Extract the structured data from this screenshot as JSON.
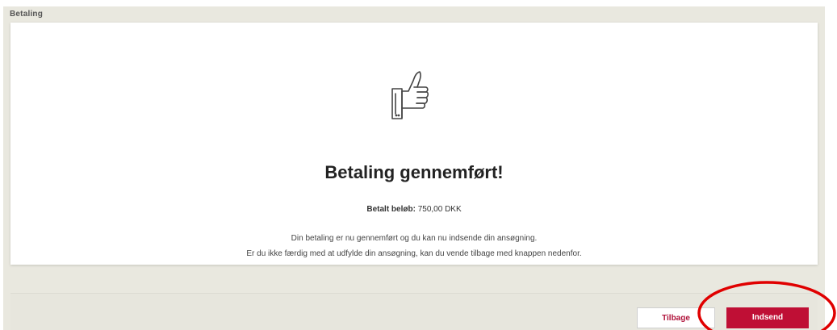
{
  "section": {
    "title": "Betaling"
  },
  "result": {
    "icon": "thumbs-up-icon",
    "title": "Betaling gennemført!",
    "amount_label": "Betalt beløb:",
    "amount_value": "750,00 DKK",
    "message_line1": "Din betaling er nu gennemført og du kan nu indsende din ansøgning.",
    "message_line2": "Er du ikke færdig med at udfylde din ansøgning, kan du vende tilbage med knappen nedenfor."
  },
  "actions": {
    "back_label": "Tilbage",
    "submit_label": "Indsend"
  },
  "colors": {
    "panel_bg": "#e9e8df",
    "primary": "#bf0f35",
    "annotation": "#e00000"
  }
}
